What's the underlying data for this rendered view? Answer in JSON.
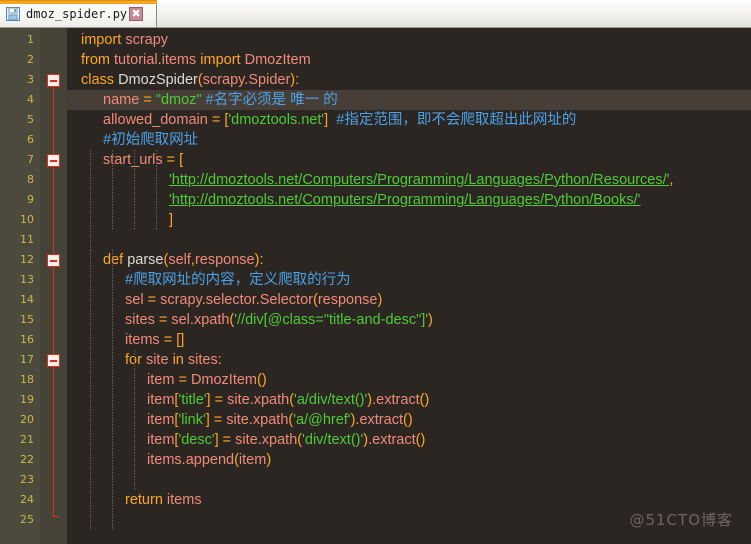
{
  "window": {
    "accent_color": "#f5a623",
    "editor_background": "#2b2622",
    "gutter_background": "#4c4a3c",
    "linenumber_color": "#c8b84a"
  },
  "tab": {
    "title": "dmoz_spider.py",
    "icon": "save-disk-icon",
    "close_label": "✖"
  },
  "editor": {
    "current_line": 4,
    "line_numbers": [
      "1",
      "2",
      "3",
      "4",
      "5",
      "6",
      "7",
      "8",
      "9",
      "10",
      "11",
      "12",
      "13",
      "14",
      "15",
      "16",
      "17",
      "18",
      "19",
      "20",
      "21",
      "22",
      "23",
      "24",
      "25"
    ],
    "lines": [
      {
        "n": "1",
        "indent": 0,
        "text": "import scrapy"
      },
      {
        "n": "2",
        "indent": 0,
        "text": "from tutorial.items import DmozItem"
      },
      {
        "n": "3",
        "indent": 0,
        "text": "class DmozSpider(scrapy.Spider):"
      },
      {
        "n": "4",
        "indent": 1,
        "text": "name = \"dmoz\" #名字必须是 唯一 的"
      },
      {
        "n": "5",
        "indent": 1,
        "text": "allowed_domain = ['dmoztools.net']  #指定范围，即不会爬取超出此网址的"
      },
      {
        "n": "6",
        "indent": 1,
        "text": "#初始爬取网址"
      },
      {
        "n": "7",
        "indent": 1,
        "text": "start_urls = ["
      },
      {
        "n": "8",
        "indent": 4,
        "text": "'http://dmoztools.net/Computers/Programming/Languages/Python/Resources/',"
      },
      {
        "n": "9",
        "indent": 4,
        "text": "'http://dmoztools.net/Computers/Programming/Languages/Python/Books/'"
      },
      {
        "n": "10",
        "indent": 4,
        "text": "]"
      },
      {
        "n": "11",
        "indent": 0,
        "text": ""
      },
      {
        "n": "12",
        "indent": 1,
        "text": "def parse(self,response):"
      },
      {
        "n": "13",
        "indent": 2,
        "text": "#爬取网址的内容，定义爬取的行为"
      },
      {
        "n": "14",
        "indent": 2,
        "text": "sel = scrapy.selector.Selector(response)"
      },
      {
        "n": "15",
        "indent": 2,
        "text": "sites = sel.xpath('//div[@class=\"title-and-desc\"]')"
      },
      {
        "n": "16",
        "indent": 2,
        "text": "items = []"
      },
      {
        "n": "17",
        "indent": 2,
        "text": "for site in sites:"
      },
      {
        "n": "18",
        "indent": 3,
        "text": "item = DmozItem()"
      },
      {
        "n": "19",
        "indent": 3,
        "text": "item['title'] = site.xpath('a/div/text()').extract()"
      },
      {
        "n": "20",
        "indent": 3,
        "text": "item['link'] = site.xpath('a/@href').extract()"
      },
      {
        "n": "21",
        "indent": 3,
        "text": "item['desc'] = site.xpath('div/text()').extract()"
      },
      {
        "n": "22",
        "indent": 3,
        "text": "items.append(item)"
      },
      {
        "n": "23",
        "indent": 0,
        "text": ""
      },
      {
        "n": "24",
        "indent": 2,
        "text": "return items"
      },
      {
        "n": "25",
        "indent": 0,
        "text": ""
      }
    ],
    "fold_markers": [
      {
        "line": "3",
        "state": "expanded",
        "glyph": "−"
      },
      {
        "line": "7",
        "state": "expanded",
        "glyph": "−"
      },
      {
        "line": "12",
        "state": "expanded",
        "glyph": "−"
      },
      {
        "line": "17",
        "state": "expanded",
        "glyph": "−"
      }
    ]
  },
  "watermark": {
    "text": "@51CTO博客"
  }
}
